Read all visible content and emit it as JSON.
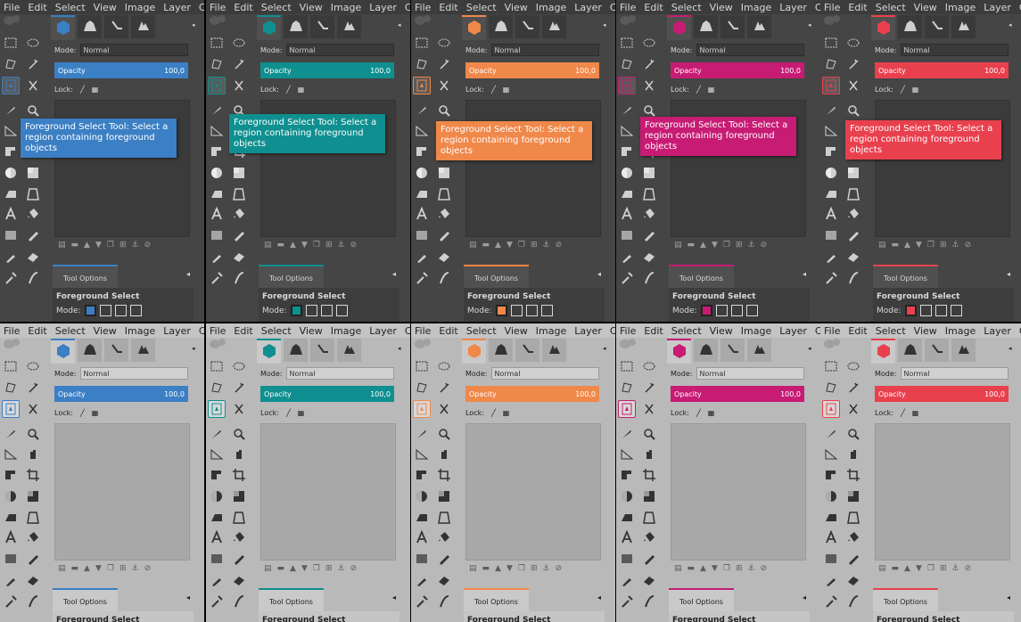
{
  "menu": [
    "File",
    "Edit",
    "Select",
    "View",
    "Image",
    "Layer",
    "Colors"
  ],
  "mode_label": "Mode:",
  "mode_value": "Normal",
  "opacity_label": "Opacity",
  "opacity_value": "100,0",
  "lock_label": "Lock:",
  "tool_options_tab": "Tool Options",
  "tool_name": "Foreground Select",
  "tooltip": "Foreground Select Tool: Select a region containing foreground objects",
  "icons": [
    "rect-select-icon",
    "ellipse-select-icon",
    "free-select-icon",
    "fuzzy-select-icon",
    "foreground-select-icon",
    "scissors-select-icon",
    "color-picker-icon",
    "zoom-icon",
    "perspective-icon",
    "move-icon",
    "align-icon",
    "crop-icon",
    "dodge-burn-icon",
    "blend-icon",
    "flip-icon",
    "cage-transform-icon",
    "text-icon",
    "bucket-fill-icon",
    "gradient-icon",
    "pencil-icon",
    "paintbrush-icon",
    "eraser-icon",
    "airbrush-icon",
    "smudge-icon"
  ],
  "themes": [
    {
      "theme": "dark",
      "accent": "#3b7fc4",
      "icon": "hexagon-blue-icon"
    },
    {
      "theme": "dark",
      "accent": "#0f8f8f",
      "icon": "hexagon-teal-icon"
    },
    {
      "theme": "dark",
      "accent": "#f0884a",
      "icon": "hexagon-orange-icon"
    },
    {
      "theme": "dark",
      "accent": "#c71b74",
      "icon": "hexagon-magenta-icon"
    },
    {
      "theme": "dark",
      "accent": "#e9404e",
      "icon": "hexagon-red-icon"
    },
    {
      "theme": "light",
      "accent": "#3b7fc4",
      "icon": "hexagon-blue-icon"
    },
    {
      "theme": "light",
      "accent": "#0f8f8f",
      "icon": "hexagon-teal-icon"
    },
    {
      "theme": "light",
      "accent": "#f0884a",
      "icon": "hexagon-orange-icon"
    },
    {
      "theme": "light",
      "accent": "#c71b74",
      "icon": "hexagon-magenta-icon"
    },
    {
      "theme": "light",
      "accent": "#e9404e",
      "icon": "hexagon-red-icon"
    }
  ]
}
